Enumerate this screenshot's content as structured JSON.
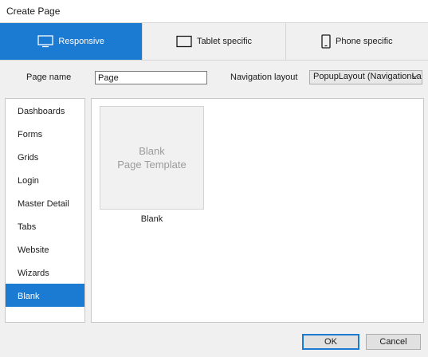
{
  "window": {
    "title": "Create Page"
  },
  "device_tabs": [
    {
      "label": "Responsive",
      "icon": "monitor-icon",
      "active": true
    },
    {
      "label": "Tablet specific",
      "icon": "tablet-icon",
      "active": false
    },
    {
      "label": "Phone specific",
      "icon": "phone-icon",
      "active": false
    }
  ],
  "form": {
    "page_name_label": "Page name",
    "page_name_value": "Page",
    "nav_layout_label": "Navigation layout",
    "nav_layout_value": "PopupLayout (NavigationLa"
  },
  "sidebar": {
    "items": [
      {
        "label": "Dashboards"
      },
      {
        "label": "Forms"
      },
      {
        "label": "Grids"
      },
      {
        "label": "Login"
      },
      {
        "label": "Master Detail"
      },
      {
        "label": "Tabs"
      },
      {
        "label": "Website"
      },
      {
        "label": "Wizards"
      },
      {
        "label": "Blank",
        "selected": true
      }
    ]
  },
  "templates": [
    {
      "thumb_line1": "Blank",
      "thumb_line2": "Page Template",
      "caption": "Blank"
    }
  ],
  "buttons": {
    "ok": "OK",
    "cancel": "Cancel"
  },
  "colors": {
    "accent": "#1b7ad1",
    "background": "#f0f0f0"
  }
}
